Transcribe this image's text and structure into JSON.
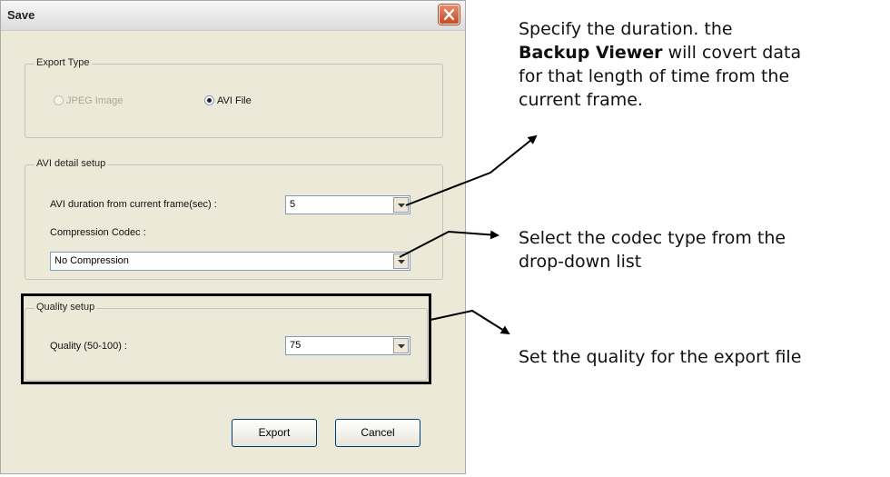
{
  "dialog": {
    "title": "Save",
    "export_type": {
      "legend": "Export Type",
      "option_jpeg": "JPEG Image",
      "option_avi": "AVI File",
      "selected": "AVI File"
    },
    "avi_setup": {
      "legend": "AVI detail setup",
      "duration_label": "AVI duration from current frame(sec) :",
      "duration_value": "5",
      "codec_label": "Compression Codec :",
      "codec_value": "No Compression"
    },
    "quality_setup": {
      "legend": "Quality setup",
      "quality_label": "Quality (50-100) :",
      "quality_value": "75"
    },
    "buttons": {
      "export": "Export",
      "cancel": "Cancel"
    }
  },
  "annotations": {
    "duration_line1": "Specify the duration. the",
    "duration_bold": "Backup Viewer",
    "duration_line2_rest": " will covert data",
    "duration_line3": "for that length of time from the",
    "duration_line4": "current frame.",
    "codec_line1": "Select the codec type from the",
    "codec_line2": "drop-down list",
    "quality": "Set the quality for the export file"
  }
}
